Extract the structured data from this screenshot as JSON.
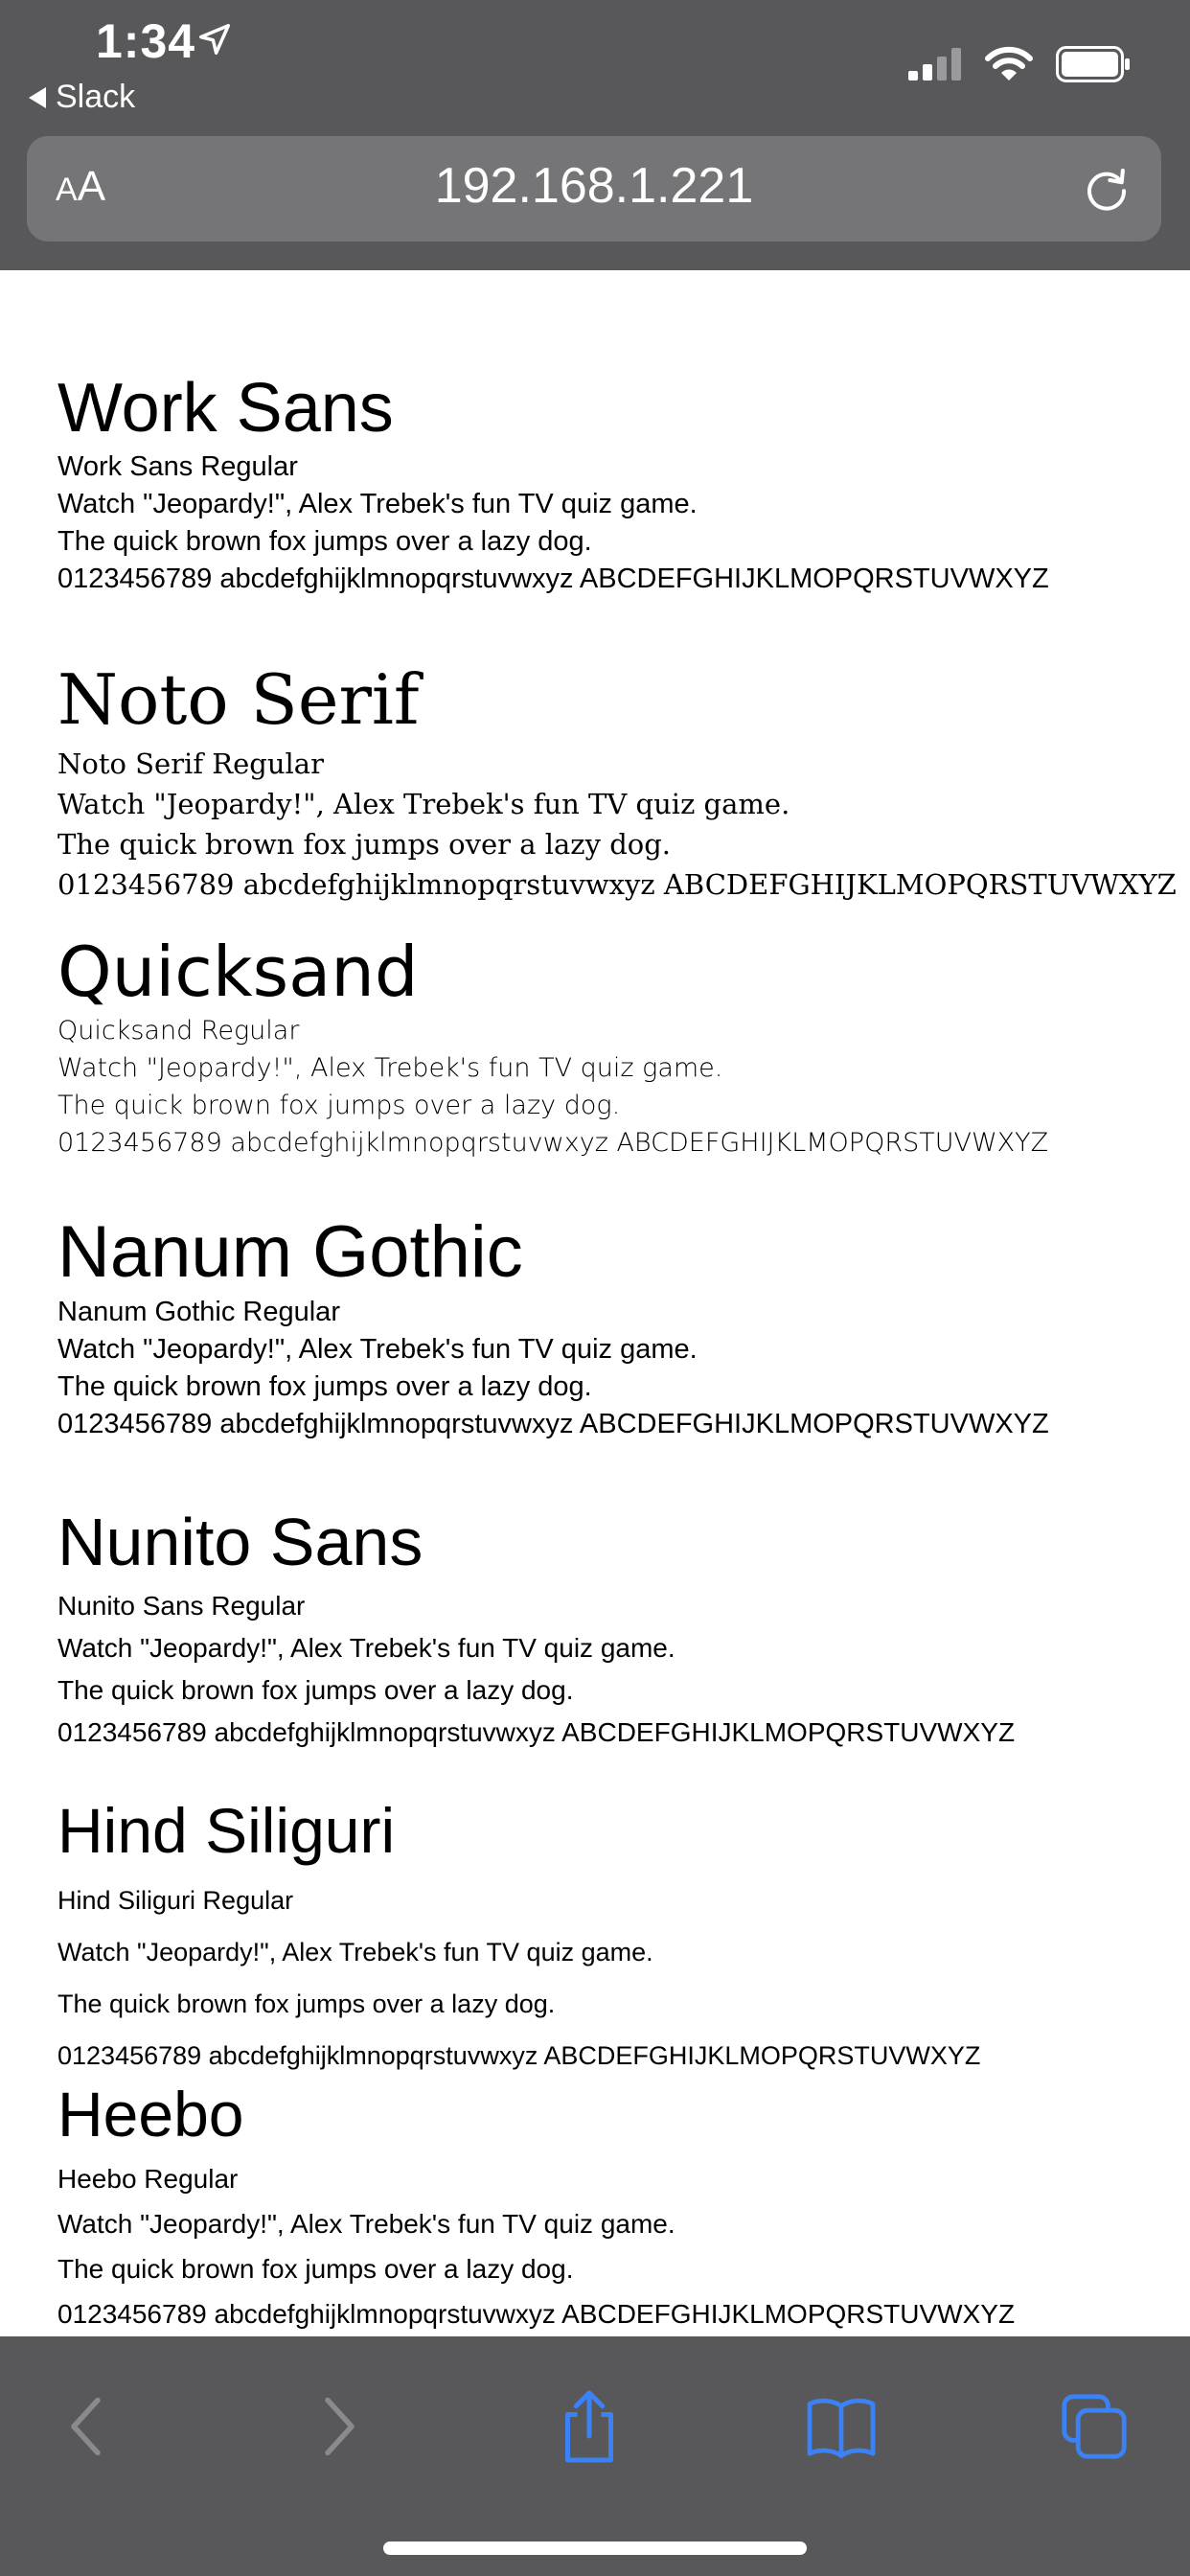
{
  "status_bar": {
    "time": "1:34",
    "back_app": "Slack"
  },
  "url_bar": {
    "text_size_label_small": "A",
    "text_size_label_large": "A",
    "url": "192.168.1.221"
  },
  "fonts": [
    {
      "title": "Work Sans",
      "subtitle": "Work Sans Regular",
      "line1": "Watch \"Jeopardy!\", Alex Trebek's fun TV quiz game.",
      "line2": "The quick brown fox jumps over a lazy dog.",
      "line3": "0123456789 abcdefghijklmnopqrstuvwxyz ABCDEFGHIJKLMOPQRSTUVWXYZ"
    },
    {
      "title": "Noto Serif",
      "subtitle": "Noto Serif Regular",
      "line1": "Watch \"Jeopardy!\", Alex Trebek's fun TV quiz game.",
      "line2": "The quick brown fox jumps over a lazy dog.",
      "line3": "0123456789 abcdefghijklmnopqrstuvwxyz ABCDEFGHIJKLMOPQRSTUVWXYZ"
    },
    {
      "title": "Quicksand",
      "subtitle": "Quicksand Regular",
      "line1": "Watch \"Jeopardy!\", Alex Trebek's fun TV quiz game.",
      "line2": "The quick brown fox jumps over a lazy dog.",
      "line3": "0123456789 abcdefghijklmnopqrstuvwxyz ABCDEFGHIJKLMOPQRSTUVWXYZ"
    },
    {
      "title": "Nanum Gothic",
      "subtitle": "Nanum Gothic Regular",
      "line1": "Watch \"Jeopardy!\", Alex Trebek's fun TV quiz game.",
      "line2": "The quick brown fox jumps over a lazy dog.",
      "line3": "0123456789 abcdefghijklmnopqrstuvwxyz ABCDEFGHIJKLMOPQRSTUVWXYZ"
    },
    {
      "title": "Nunito Sans",
      "subtitle": "Nunito Sans Regular",
      "line1": "Watch \"Jeopardy!\", Alex Trebek's fun TV quiz game.",
      "line2": "The quick brown fox jumps over a lazy dog.",
      "line3": "0123456789 abcdefghijklmnopqrstuvwxyz ABCDEFGHIJKLMOPQRSTUVWXYZ"
    },
    {
      "title": "Hind Siliguri",
      "subtitle": "Hind Siliguri Regular",
      "line1": "Watch \"Jeopardy!\", Alex Trebek's fun TV quiz game.",
      "line2": "The quick brown fox jumps over a lazy dog.",
      "line3": "0123456789 abcdefghijklmnopqrstuvwxyz ABCDEFGHIJKLMOPQRSTUVWXYZ"
    },
    {
      "title": "Heebo",
      "subtitle": "Heebo Regular",
      "line1": "Watch \"Jeopardy!\", Alex Trebek's fun TV quiz game.",
      "line2": "The quick brown fox jumps over a lazy dog.",
      "line3": "0123456789 abcdefghijklmnopqrstuvwxyz ABCDEFGHIJKLMOPQRSTUVWXYZ"
    }
  ],
  "toolbar": {
    "icons": [
      "back-icon",
      "forward-icon",
      "share-icon",
      "bookmarks-icon",
      "tabs-icon"
    ]
  },
  "colors": {
    "chrome_background": "#58585a",
    "url_field": "#757577",
    "accent_blue": "#3b82f6",
    "disabled_icon": "#8a8a8c"
  }
}
